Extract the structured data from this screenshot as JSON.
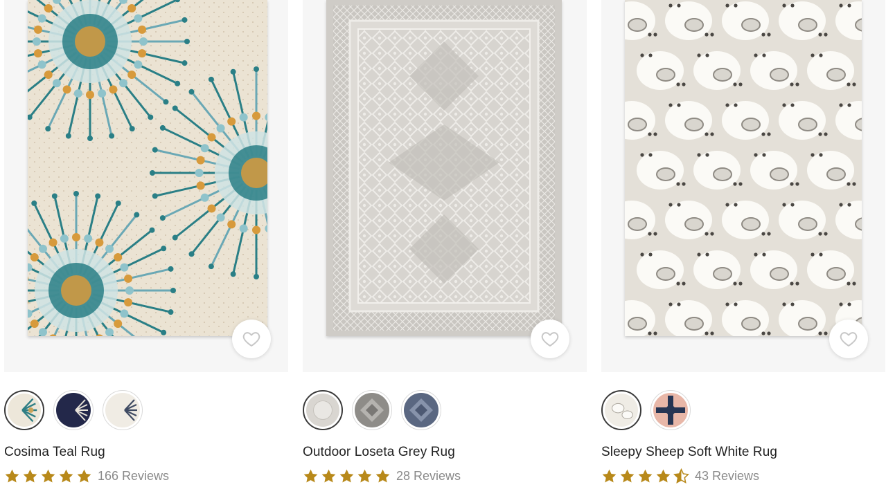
{
  "colors": {
    "star": "#b8891a",
    "name_text": "#222222",
    "reviews_text": "#8a8a8a"
  },
  "products": [
    {
      "name": "Cosima Teal Rug",
      "reviews": "166 Reviews",
      "rating": 5,
      "swatch_count": 3,
      "selected_swatch": 0
    },
    {
      "name": "Outdoor Loseta Grey Rug",
      "reviews": "28 Reviews",
      "rating": 5,
      "swatch_count": 3,
      "selected_swatch": 0
    },
    {
      "name": "Sleepy Sheep Soft White Rug",
      "reviews": "43 Reviews",
      "rating": 4.5,
      "swatch_count": 2,
      "selected_swatch": 0
    }
  ],
  "icons": {
    "wishlist": "heart-outline-icon",
    "rating": "star-icon"
  }
}
